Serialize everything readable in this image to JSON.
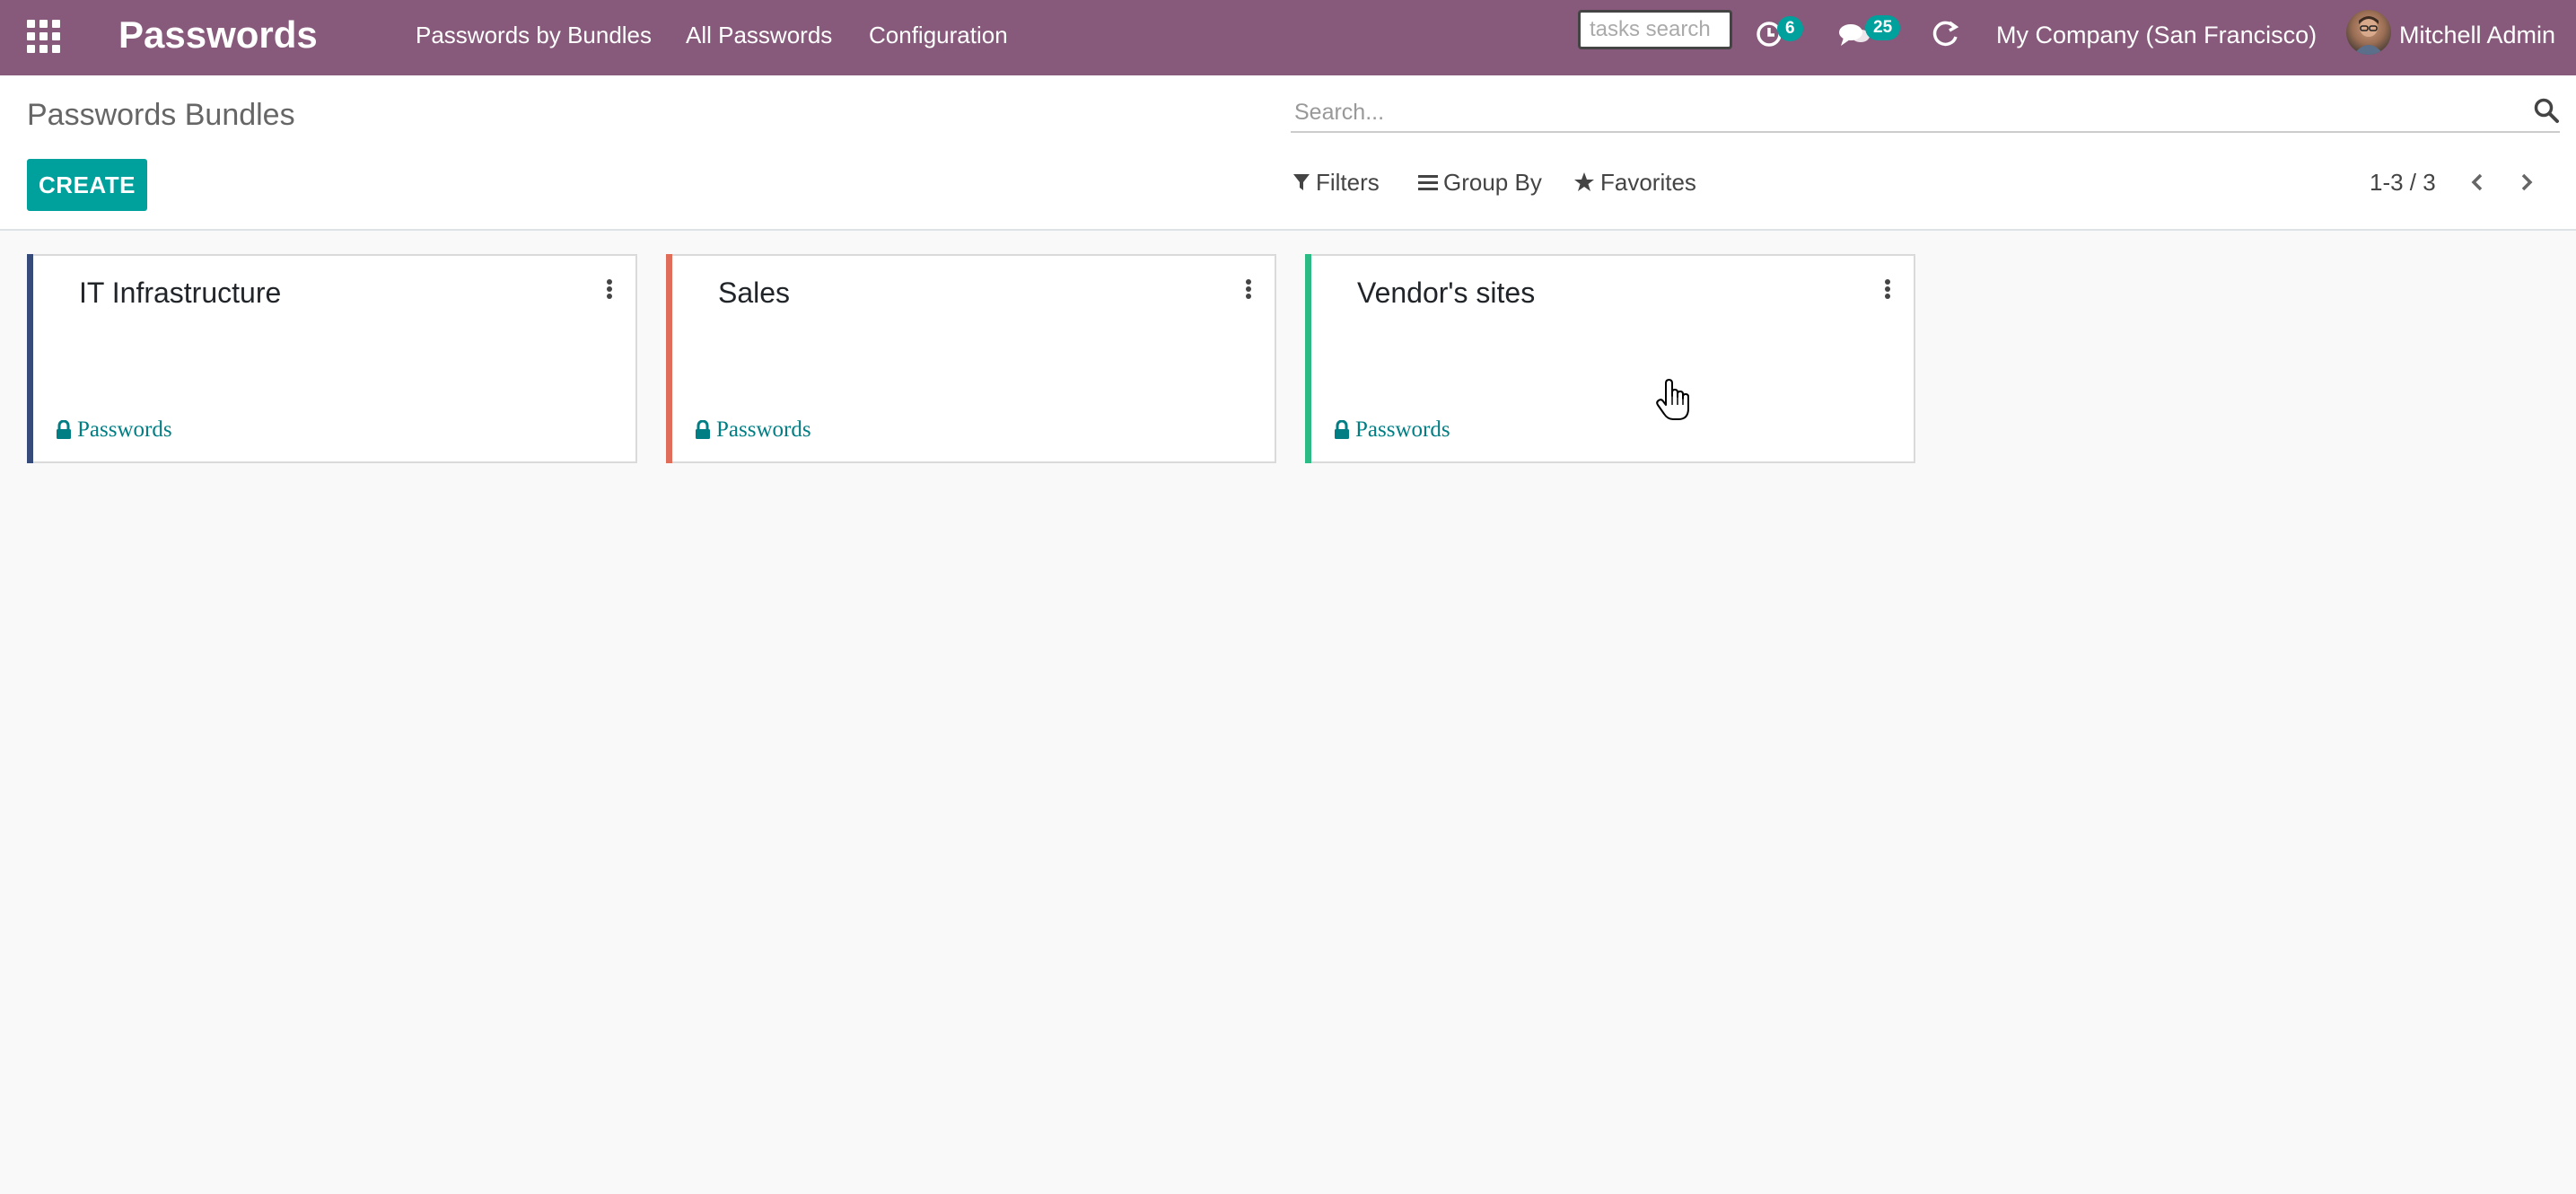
{
  "navbar": {
    "app_name": "Passwords",
    "menu": [
      "Passwords by Bundles",
      "All Passwords",
      "Configuration"
    ],
    "tasks_search_placeholder": "tasks search",
    "activity_count": "6",
    "messages_count": "25",
    "company": "My Company (San Francisco)",
    "user": "Mitchell Admin"
  },
  "control_panel": {
    "title": "Passwords Bundles",
    "create_label": "CREATE",
    "search_placeholder": "Search...",
    "filters_label": "Filters",
    "group_by_label": "Group By",
    "favorites_label": "Favorites",
    "pager": "1-3 / 3"
  },
  "cards": [
    {
      "title": "IT Infrastructure",
      "link": "Passwords",
      "color": "#374b7a"
    },
    {
      "title": "Sales",
      "link": "Passwords",
      "color": "#e06c5a"
    },
    {
      "title": "Vendor's sites",
      "link": "Passwords",
      "color": "#2cbb85"
    }
  ],
  "colors": {
    "navbar": "#875a7b",
    "primary": "#00a09d",
    "link": "#017e84"
  }
}
